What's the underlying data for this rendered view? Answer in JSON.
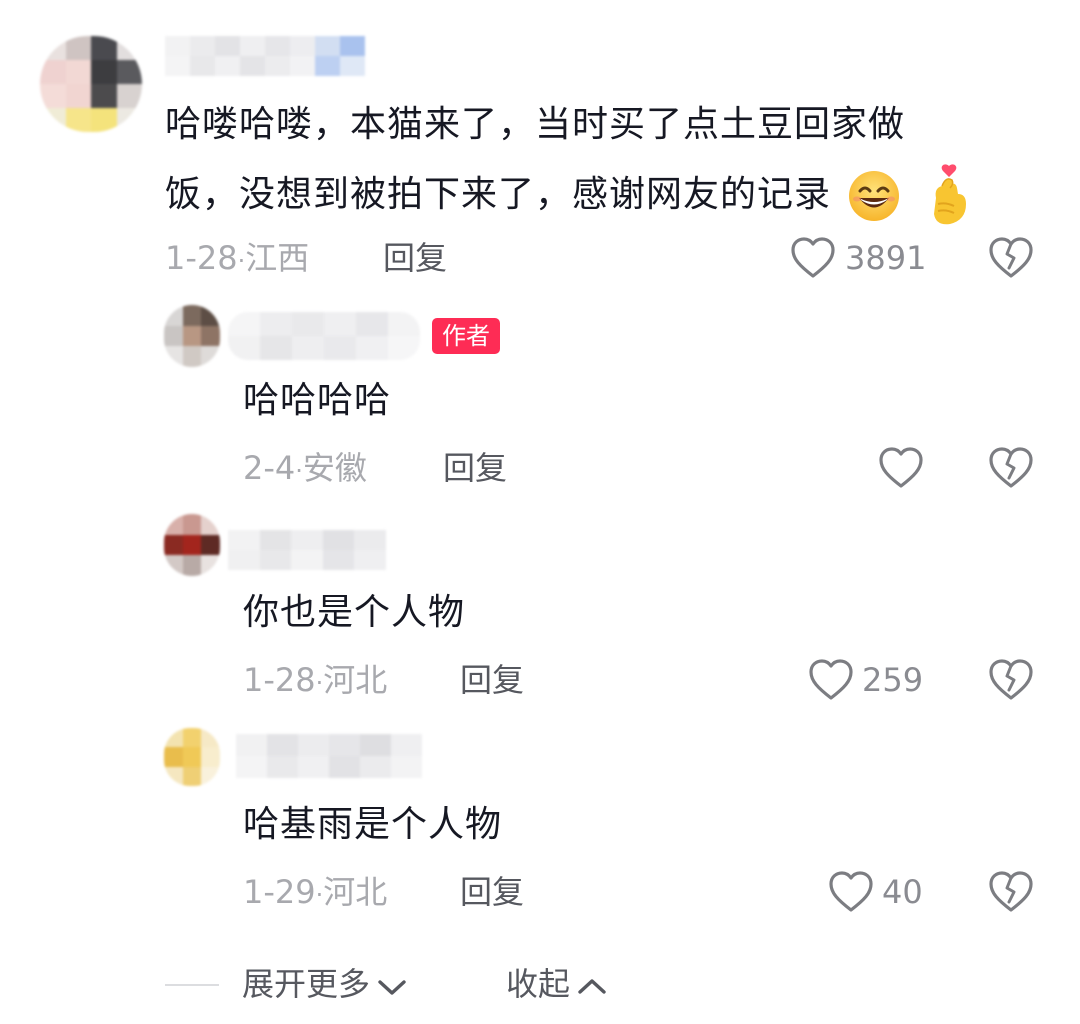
{
  "comments": [
    {
      "text_line1": "哈喽哈喽，本猫来了，当时买了点土豆回家做",
      "text_line2": "饭，没想到被拍下来了，感谢网友的记录",
      "emoji1": "grinning-face-emoji",
      "emoji2": "finger-heart-emoji",
      "date": "1-28",
      "location": "江西",
      "reply_label": "回复",
      "likes": "3891"
    },
    {
      "badge": "作者",
      "text": "哈哈哈哈",
      "date": "2-4",
      "location": "安徽",
      "reply_label": "回复",
      "likes": ""
    },
    {
      "text": "你也是个人物",
      "date": "1-28",
      "location": "河北",
      "reply_label": "回复",
      "likes": "259"
    },
    {
      "text": "哈基雨是个人物",
      "date": "1-29",
      "location": "河北",
      "reply_label": "回复",
      "likes": "40"
    }
  ],
  "footer": {
    "expand_label": "展开更多",
    "collapse_label": "收起"
  },
  "icons": {
    "like": "heart-outline-icon",
    "dislike": "broken-heart-icon",
    "expand": "chevron-down-icon",
    "collapse": "chevron-up-icon"
  },
  "colors": {
    "author_badge": "#fe2c55",
    "meta_text": "#a8a9ae",
    "reply_text": "#56585f"
  }
}
